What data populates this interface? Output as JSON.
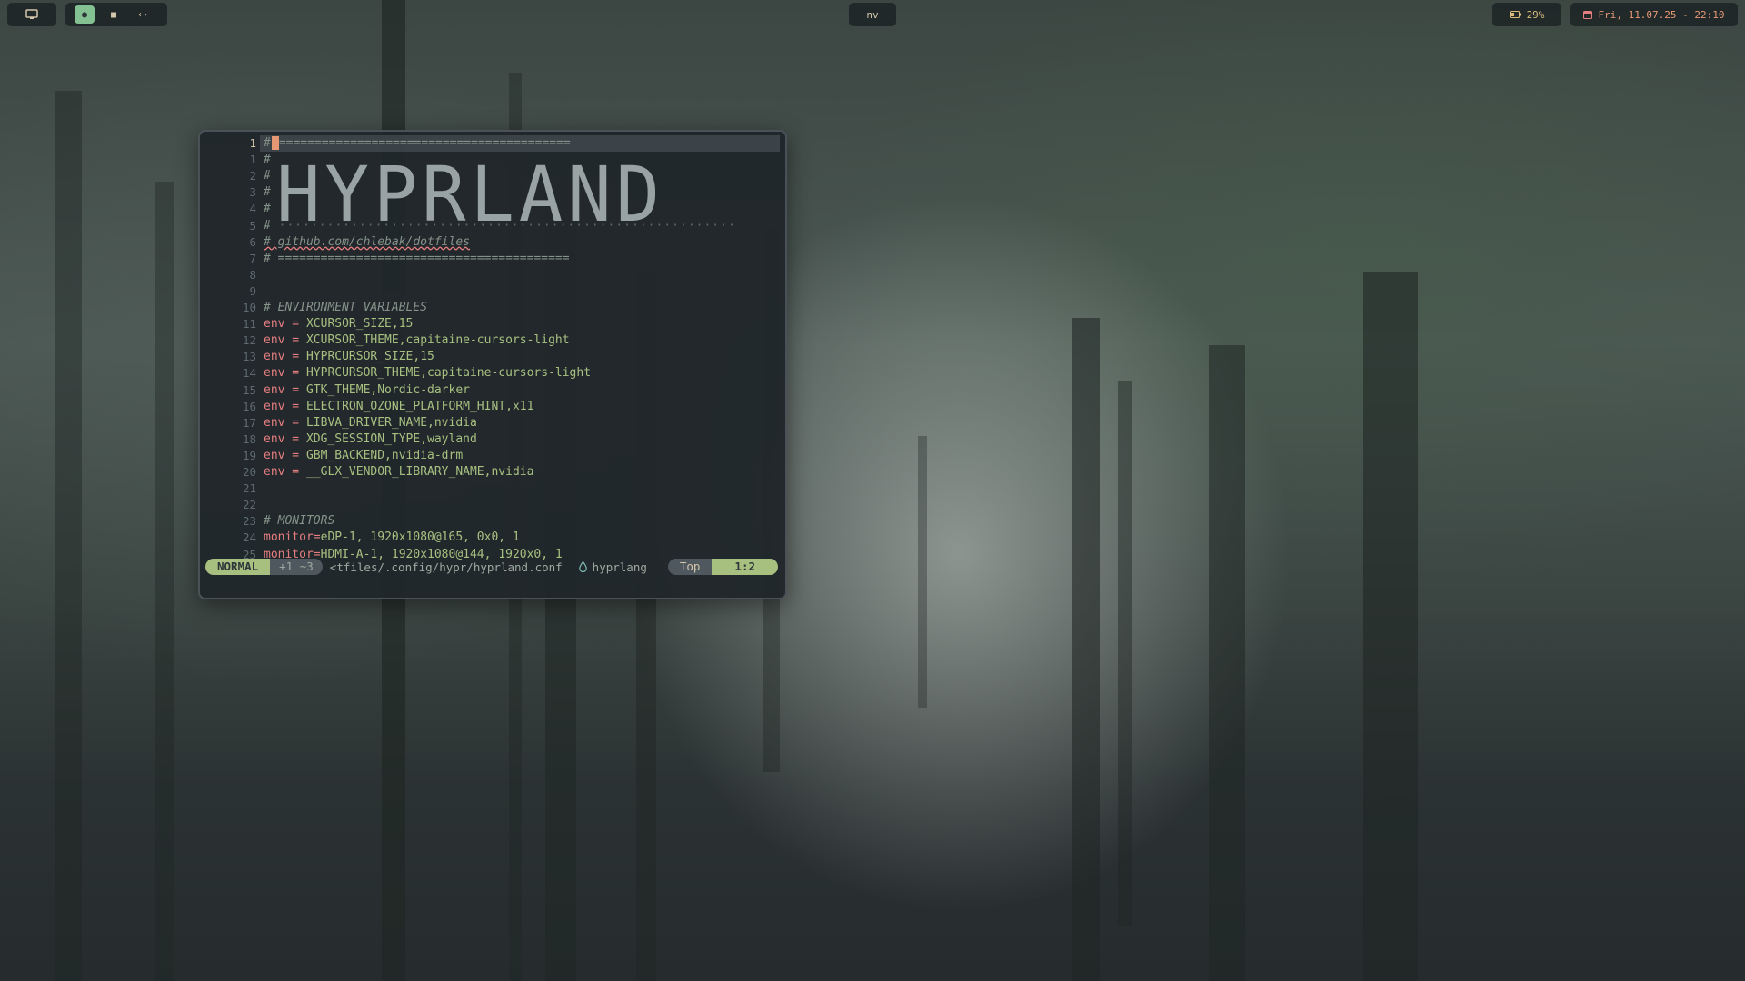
{
  "topbar": {
    "workspaces": [
      "●",
      "■",
      "‹›"
    ],
    "window_title": "nv",
    "battery": "29%",
    "datetime": "Fri, 11.07.25 - 22:10"
  },
  "editor": {
    "lines": [
      {
        "num": "1",
        "text": "#"
      },
      {
        "num": "1",
        "text": "#"
      },
      {
        "num": "2",
        "text": "#"
      },
      {
        "num": "3",
        "text": "#"
      },
      {
        "num": "4",
        "text": "#"
      },
      {
        "num": "5",
        "text": "#"
      },
      {
        "num": "6",
        "text": "# github.com/chlebak/dotfiles"
      },
      {
        "num": "7",
        "text": "# ========================================="
      },
      {
        "num": "8",
        "text": ""
      },
      {
        "num": "9",
        "text": ""
      },
      {
        "num": "10",
        "text": "# ENVIRONMENT VARIABLES"
      },
      {
        "num": "11",
        "key": "env",
        "op": " = ",
        "value": "XCURSOR_SIZE,15"
      },
      {
        "num": "12",
        "key": "env",
        "op": " = ",
        "value": "XCURSOR_THEME,capitaine-cursors-light"
      },
      {
        "num": "13",
        "key": "env",
        "op": " = ",
        "value": "HYPRCURSOR_SIZE,15"
      },
      {
        "num": "14",
        "key": "env",
        "op": " = ",
        "value": "HYPRCURSOR_THEME,capitaine-cursors-light"
      },
      {
        "num": "15",
        "key": "env",
        "op": " = ",
        "value": "GTK_THEME,Nordic-darker"
      },
      {
        "num": "16",
        "key": "env",
        "op": " = ",
        "value": "ELECTRON_OZONE_PLATFORM_HINT,x11"
      },
      {
        "num": "17",
        "key": "env",
        "op": " = ",
        "value": "LIBVA_DRIVER_NAME,nvidia"
      },
      {
        "num": "18",
        "key": "env",
        "op": " = ",
        "value": "XDG_SESSION_TYPE,wayland"
      },
      {
        "num": "19",
        "key": "env",
        "op": " = ",
        "value": "GBM_BACKEND,nvidia-drm"
      },
      {
        "num": "20",
        "key": "env",
        "op": " = ",
        "value": "__GLX_VENDOR_LIBRARY_NAME,nvidia"
      },
      {
        "num": "21",
        "text": ""
      },
      {
        "num": "22",
        "text": ""
      },
      {
        "num": "23",
        "text": "# MONITORS"
      },
      {
        "num": "24",
        "key": "monitor",
        "op": "=",
        "value": "eDP-1, 1920x1080@165, 0x0, 1"
      },
      {
        "num": "25",
        "key": "monitor",
        "op": "=",
        "value": "HDMI-A-1, 1920x1080@144, 1920x0, 1"
      }
    ],
    "first_line_rule": "=========================================",
    "banner": "HYPRLAND",
    "dotted_rule": "·························································",
    "statusline": {
      "mode": "NORMAL",
      "diff": "+1 ~3",
      "file": "<tfiles/.config/hypr/hyprland.conf",
      "filetype": "hyprlang",
      "position": "Top",
      "line_col": "1:2"
    }
  },
  "colors": {
    "accent": "#a7c080",
    "keyword": "#e67e80",
    "comment": "#859289",
    "cursor": "#e69875",
    "background": "#20272b"
  }
}
